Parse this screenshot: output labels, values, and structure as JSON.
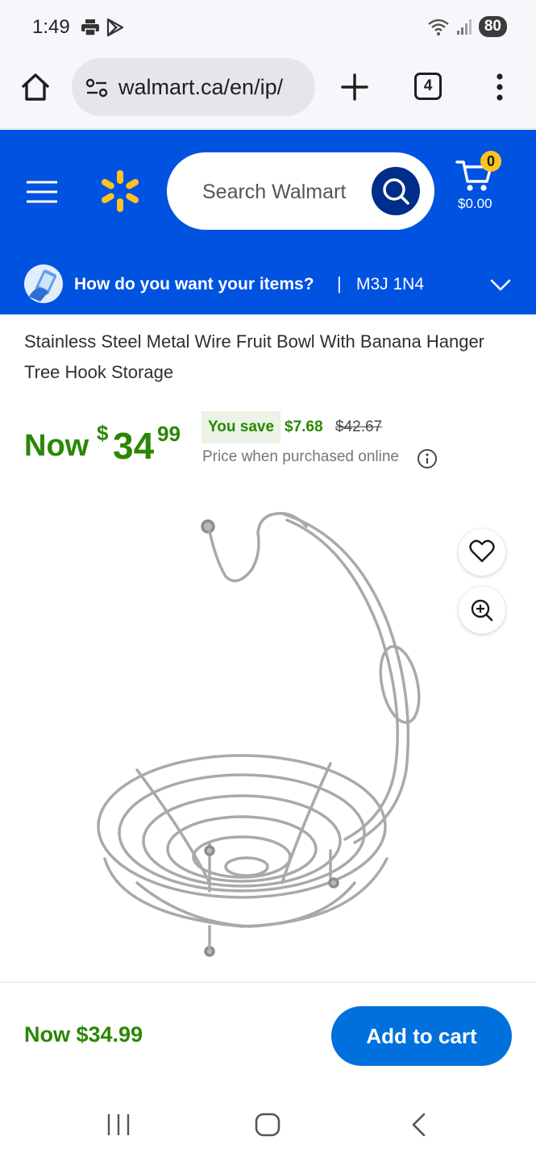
{
  "status_bar": {
    "time": "1:49",
    "battery": "80",
    "icons_left": [
      "print-icon",
      "play-store-icon"
    ],
    "icons_right": [
      "wifi-icon",
      "signal-icon"
    ]
  },
  "browser": {
    "url": "walmart.ca/en/ip/",
    "tab_count": "4"
  },
  "header": {
    "search_placeholder": "Search Walmart",
    "cart_count": "0",
    "cart_total": "$0.00",
    "brand_color": "#0052e0",
    "spark_color": "#ffc220"
  },
  "fulfillment": {
    "question": "How do you want your items?",
    "separator": "|",
    "postal_code": "M3J 1N4"
  },
  "product": {
    "title": "Stainless Steel Metal Wire Fruit Bowl With Banana Hanger Tree Hook Storage",
    "price_label": "Now",
    "price_currency": "$",
    "price_whole": "34",
    "price_cents": "99",
    "you_save_label": "You save",
    "save_amount": "$7.68",
    "was_price": "$42.67",
    "price_note": "Price when purchased online",
    "price_color": "#2a8703"
  },
  "sticky_bar": {
    "price_text": "Now $34.99",
    "add_to_cart_label": "Add to cart",
    "button_color": "#0071dc"
  },
  "android_nav": {
    "buttons": [
      "recents-icon",
      "home-icon",
      "back-icon"
    ]
  }
}
